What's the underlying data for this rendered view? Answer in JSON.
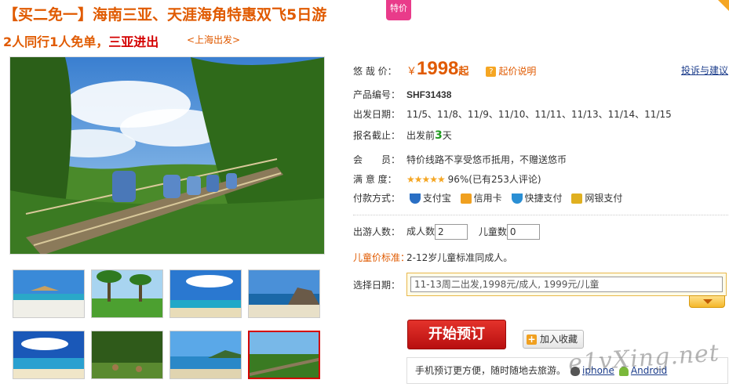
{
  "header": {
    "title": "【买二免一】海南三亚、天涯海角特惠双飞5日游",
    "special_badge": "特价",
    "subtitle_part1": "2人同行1人免单，",
    "subtitle_part2": "三亚进出",
    "departure": "<上海出发>"
  },
  "gallery": {
    "main_photo": "suspension-bridge-rainforest",
    "thumbnails": [
      "beach-umbrella",
      "palm-lawn",
      "beach-blue-sky",
      "coast-rocks",
      "sea-beach",
      "forest-deer",
      "bay-island",
      "suspension-bridge"
    ],
    "active_thumbnail": 7
  },
  "info": {
    "complain_link": "投诉与建议",
    "price": {
      "label": "悠 哉 价：",
      "currency": "￥",
      "amount": "1998",
      "suffix": "起",
      "help_icon": "question-icon",
      "help_text": "起价说明"
    },
    "product_code": {
      "label": "产品编号：",
      "value": "SHF31438"
    },
    "departure_dates": {
      "label": "出发日期：",
      "value": "11/5、11/8、11/9、11/10、11/11、11/13、11/14、11/15"
    },
    "deadline": {
      "label": "报名截止：",
      "prefix": "出发前",
      "days": "3",
      "suffix": "天"
    },
    "member": {
      "label": "会　　员：",
      "value": "特价线路不享受悠币抵用，不赠送悠币"
    },
    "satisfaction": {
      "label": "满 意 度：",
      "stars": "★★★★★",
      "rating": 5,
      "value": "96%(已有253人评论)"
    },
    "payment": {
      "label": "付款方式：",
      "methods": [
        {
          "icon": "alipay-shield-icon",
          "label": "支付宝",
          "color": "#2a6fc4"
        },
        {
          "icon": "credit-card-icon",
          "label": "信用卡",
          "color": "#f0a020"
        },
        {
          "icon": "quick-pay-shield-icon",
          "label": "快捷支付",
          "color": "#2a8fd4"
        },
        {
          "icon": "unionpay-icon",
          "label": "网银支付",
          "color": "#e0b020"
        }
      ]
    },
    "travelers": {
      "label": "出游人数：",
      "adult_label": "成人数",
      "adult_value": "2",
      "child_label": "儿童数",
      "child_value": "0"
    },
    "child_price": {
      "label": "儿童价标准：",
      "value": "2-12岁儿童标准同成人。"
    },
    "date_select": {
      "label": "选择日期：",
      "value": "11-13周二出发,1998元/成人, 1999元/儿童"
    },
    "book_button": "开始预订",
    "favorite_button": "加入收藏",
    "mobile": {
      "text": "手机预订更方便，随时随地去旅游。",
      "iphone": "iphone",
      "android": "Android"
    }
  },
  "watermark": "e1vXing.net",
  "colors": {
    "accent": "#e05a00",
    "red": "#d40000",
    "link": "#1a3b8a",
    "green": "#1f9a1f"
  }
}
